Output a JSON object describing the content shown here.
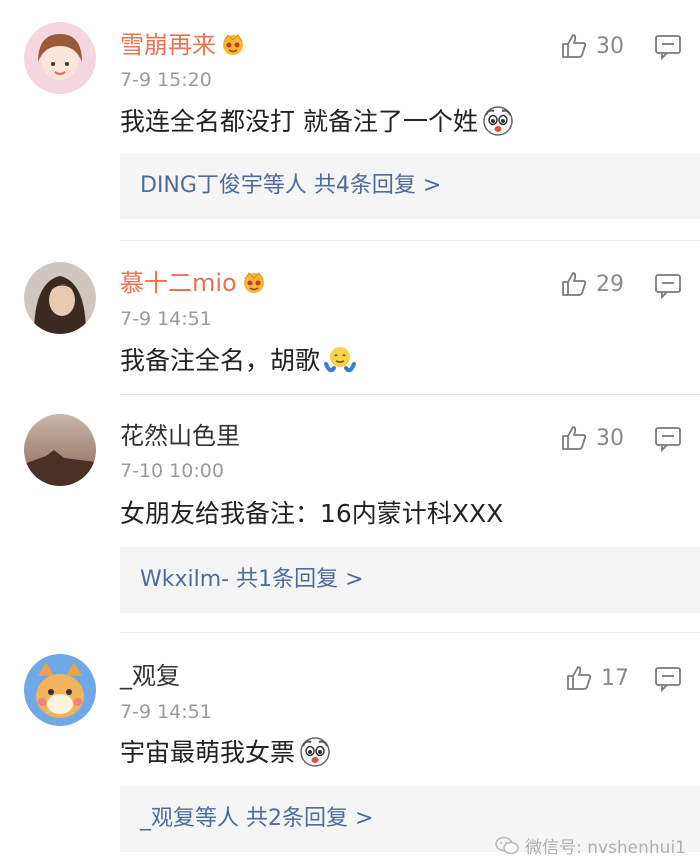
{
  "comments": [
    {
      "username": "雪崩再来",
      "time": "7-9 15:20",
      "text": "我连全名都没打 就备注了一个姓",
      "likes": "30",
      "replies_summary": "DING丁俊宇等人  共4条回复 >"
    },
    {
      "username": "慕十二mio",
      "time": "7-9 14:51",
      "text": "我备注全名，胡歌",
      "likes": "29"
    },
    {
      "username": "花然山色里",
      "time": "7-10 10:00",
      "text": "女朋友给我备注：16内蒙计科XXX",
      "likes": "30",
      "replies_summary": "Wkxilm-  共1条回复 >"
    },
    {
      "username": "_观复",
      "time": "7-9 14:51",
      "text": "宇宙最萌我女票",
      "likes": "17",
      "replies_summary": "_观复等人  共2条回复 >"
    }
  ],
  "watermark": "微信号: nvshenhui1",
  "colors": {
    "vip_name": "#eb7350",
    "reply_link": "#4d6c9c",
    "reply_bg": "#f5f5f5",
    "meta_gray": "#9a9a9a"
  },
  "icons": {
    "like": "thumbs-up-icon",
    "reply": "comment-icon",
    "vip_badge": "vip-crown-icon"
  }
}
